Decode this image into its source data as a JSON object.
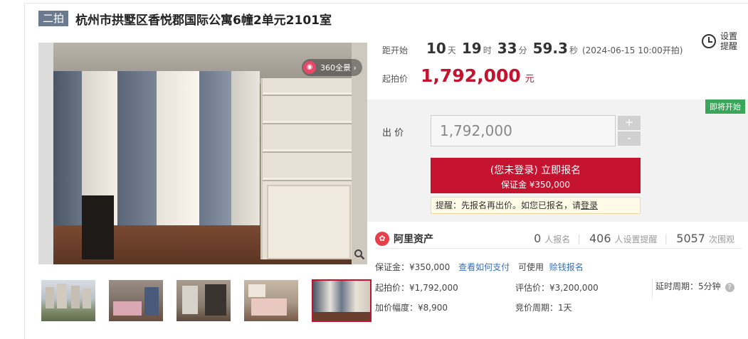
{
  "header": {
    "badge": "二拍",
    "title": "杭州市拱墅区香悦郡国际公寓6幢2单元2101室"
  },
  "gallery": {
    "pano_label": "360全景 ›",
    "pano_icon": "panorama-icon",
    "zoom_icon": "magnifier-icon",
    "thumbnail_count": 5,
    "active_thumbnail_index": 5
  },
  "countdown": {
    "label": "距开始",
    "days": "10",
    "days_unit": "天",
    "hours": "19",
    "hours_unit": "时",
    "minutes": "33",
    "minutes_unit": "分",
    "seconds": "59.3",
    "seconds_unit": "秒",
    "start_note": "(2024-06-15 10:00开拍)"
  },
  "reminder": {
    "label_line1": "设置",
    "label_line2": "提醒"
  },
  "start_price": {
    "label": "起拍价",
    "value": "1,792,000",
    "unit": "元"
  },
  "bid": {
    "status_tag": "即将开始",
    "label": "出  价",
    "input_value": "1,792,000",
    "plus_label": "+",
    "minus_label": "-",
    "signup_main": "(您未登录) 立即报名",
    "signup_sub": "保证金 ¥350,000",
    "tip_prefix": "提醒：先报名再出价。如您已报名，请",
    "tip_link": "登录"
  },
  "platform": {
    "name": "阿里资产",
    "logo_text": "✿",
    "signups": "0",
    "signups_label": "人报名",
    "reminders": "406",
    "reminders_label": "人设置提醒",
    "watchers": "5057",
    "watchers_label": "次围观"
  },
  "details": {
    "deposit_label": "保证金：¥350,000",
    "how_to_pay": "查看如何支付",
    "usable_label": "可使用",
    "deposit_signup_link": "赊钱报名",
    "start_price_label": "起拍价：¥1,792,000",
    "appraisal_label": "评估价：¥3,200,000",
    "delay_label": "延时周期：5分钟",
    "increment_label": "加价幅度：¥8,900",
    "cycle_label": "竞价周期：1天"
  },
  "colors": {
    "accent": "#c4122f",
    "green_tag": "#3aa65a",
    "badge_bg": "#6b7b8f"
  }
}
